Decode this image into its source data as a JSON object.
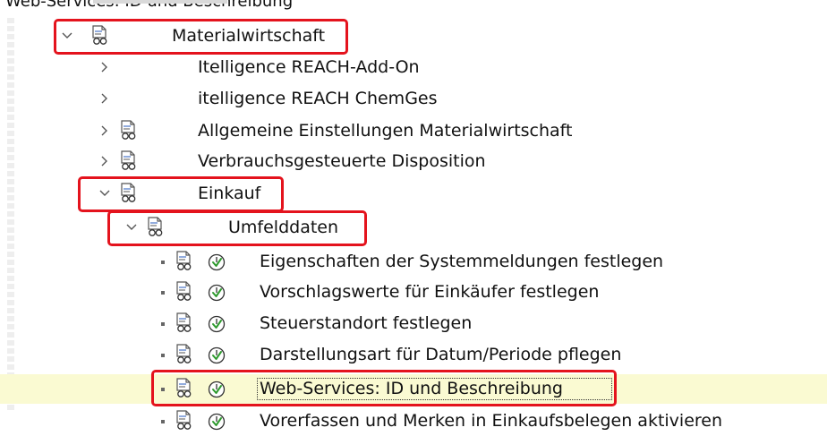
{
  "caption": "Web-Services: ID und Beschreibung",
  "tree": [
    {
      "label": "Materialwirtschaft",
      "expanded": true,
      "icon": "document-glasses-icon"
    },
    {
      "label": "Itelligence REACH-Add-On",
      "expanded": false,
      "icon": null
    },
    {
      "label": "itelligence REACH ChemGes",
      "expanded": false,
      "icon": null
    },
    {
      "label": "Allgemeine Einstellungen Materialwirtschaft",
      "expanded": false,
      "icon": "document-glasses-icon"
    },
    {
      "label": "Verbrauchsgesteuerte Disposition",
      "expanded": false,
      "icon": "document-glasses-icon"
    },
    {
      "label": "Einkauf",
      "expanded": true,
      "icon": "document-glasses-icon"
    },
    {
      "label": "Umfelddaten",
      "expanded": true,
      "icon": "document-glasses-icon"
    },
    {
      "label": "Eigenschaften der Systemmeldungen festlegen",
      "leaf": true,
      "icon": "execute-clock-icon"
    },
    {
      "label": "Vorschlagswerte für Einkäufer festlegen",
      "leaf": true,
      "icon": "execute-clock-icon"
    },
    {
      "label": "Steuerstandort festlegen",
      "leaf": true,
      "icon": "execute-clock-icon"
    },
    {
      "label": "Darstellungsart für Datum/Periode pflegen",
      "leaf": true,
      "icon": "execute-clock-icon"
    },
    {
      "label": "Web-Services: ID und Beschreibung",
      "leaf": true,
      "selected": true,
      "icon": "execute-clock-icon"
    },
    {
      "label": "Vorerfassen und Merken in Einkaufsbelegen aktivieren",
      "leaf": true,
      "icon": "execute-clock-icon"
    }
  ],
  "colors": {
    "highlight": "#e4131d",
    "selected_row": "#fafad2",
    "icon_check": "#2e9a2e"
  }
}
